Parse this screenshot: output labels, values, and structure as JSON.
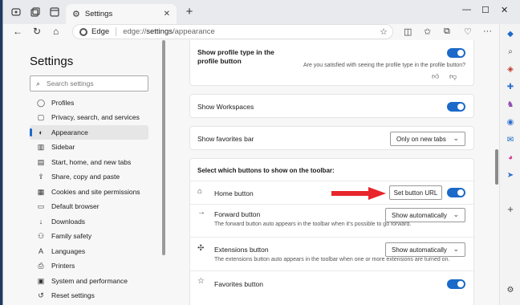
{
  "tabs": {
    "active_title": "Settings"
  },
  "address": {
    "brand": "Edge",
    "url_prefix": "edge://",
    "url_bold": "settings",
    "url_rest": "/appearance"
  },
  "sidebar": {
    "title": "Settings",
    "search_placeholder": "Search settings",
    "items": [
      {
        "label": "Profiles",
        "icon": "profile-icon"
      },
      {
        "label": "Privacy, search, and services",
        "icon": "lock-icon"
      },
      {
        "label": "Appearance",
        "icon": "appearance-icon",
        "active": true
      },
      {
        "label": "Sidebar",
        "icon": "sidebar-icon"
      },
      {
        "label": "Start, home, and new tabs",
        "icon": "home-tabs-icon"
      },
      {
        "label": "Share, copy and paste",
        "icon": "share-icon"
      },
      {
        "label": "Cookies and site permissions",
        "icon": "cookies-icon"
      },
      {
        "label": "Default browser",
        "icon": "browser-icon"
      },
      {
        "label": "Downloads",
        "icon": "download-icon"
      },
      {
        "label": "Family safety",
        "icon": "family-icon"
      },
      {
        "label": "Languages",
        "icon": "languages-icon"
      },
      {
        "label": "Printers",
        "icon": "printer-icon"
      },
      {
        "label": "System and performance",
        "icon": "system-icon"
      },
      {
        "label": "Reset settings",
        "icon": "reset-icon"
      }
    ]
  },
  "content": {
    "profile_type": {
      "label": "Show profile type in the profile button",
      "feedback": "Are you satisfied with seeing the profile type in the profile button?",
      "enabled": true
    },
    "workspaces": {
      "label": "Show Workspaces",
      "enabled": true
    },
    "favorites_bar": {
      "label": "Show favorites bar",
      "value": "Only on new tabs"
    },
    "toolbar_section": {
      "heading": "Select which buttons to show on the toolbar:",
      "home": {
        "label": "Home button",
        "button": "Set button URL",
        "enabled": true
      },
      "forward": {
        "label": "Forward button",
        "desc": "The forward button auto appears in the toolbar when it's possible to go forward.",
        "value": "Show automatically"
      },
      "extensions": {
        "label": "Extensions button",
        "desc": "The extensions button auto appears in the toolbar when one or more extensions are turned on.",
        "value": "Show automatically"
      },
      "favorites": {
        "label": "Favorites button",
        "enabled": true
      }
    }
  },
  "colors": {
    "accent": "#1b69c8",
    "arrow": "#e8252a"
  }
}
